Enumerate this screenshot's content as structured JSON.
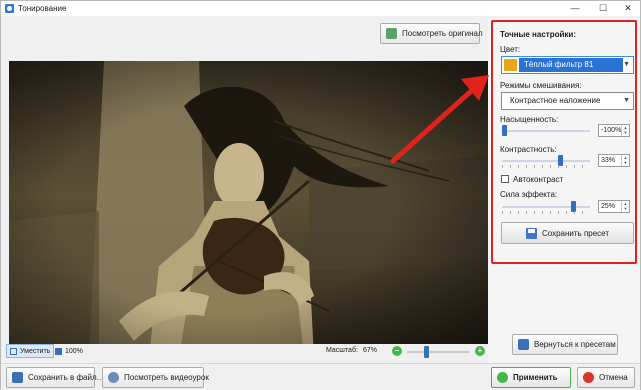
{
  "window": {
    "title": "Тонирование",
    "minimize_glyph": "—",
    "maximize_glyph": "☐",
    "close_glyph": "✕"
  },
  "toolbar": {
    "view_original_label": "Посмотреть оригинал",
    "view_original_icon": "eye-icon"
  },
  "statusbar": {
    "fit_label": "Уместить",
    "zoom_100_label": "100%",
    "scale_label": "Масштаб:",
    "scale_value": "67%",
    "zoom_level": 0.3
  },
  "footer": {
    "save_file_label": "Сохранить в файл...",
    "watch_video_label": "Посмотреть видеоурок",
    "apply_label": "Применить",
    "cancel_label": "Отмена"
  },
  "settings": {
    "heading": "Точные настройки:",
    "color_label": "Цвет:",
    "color_value": "Тёплый фильтр 81",
    "color_swatch": "#e9a51b",
    "blend_label": "Режимы смешивания:",
    "blend_value": "Контрастное наложение",
    "saturation_label": "Насыщенность:",
    "saturation_value": "-100%",
    "saturation_level": 0.0,
    "contrast_label": "Контрастность:",
    "contrast_value": "33%",
    "contrast_level": 0.67,
    "autocontrast_label": "Автоконтраст",
    "autocontrast_checked": false,
    "strength_label": "Сила эффекта:",
    "strength_value": "25%",
    "strength_level": 0.83,
    "save_preset_label": "Сохранить пресет"
  },
  "presets": {
    "back_label": "Вернуться к пресетам"
  },
  "colors": {
    "accent_blue": "#2a73d4",
    "highlight_red": "#e0221d",
    "apply_green": "#43b74a",
    "cancel_red": "#d9362b",
    "photo_tint": "#b9a77c"
  }
}
